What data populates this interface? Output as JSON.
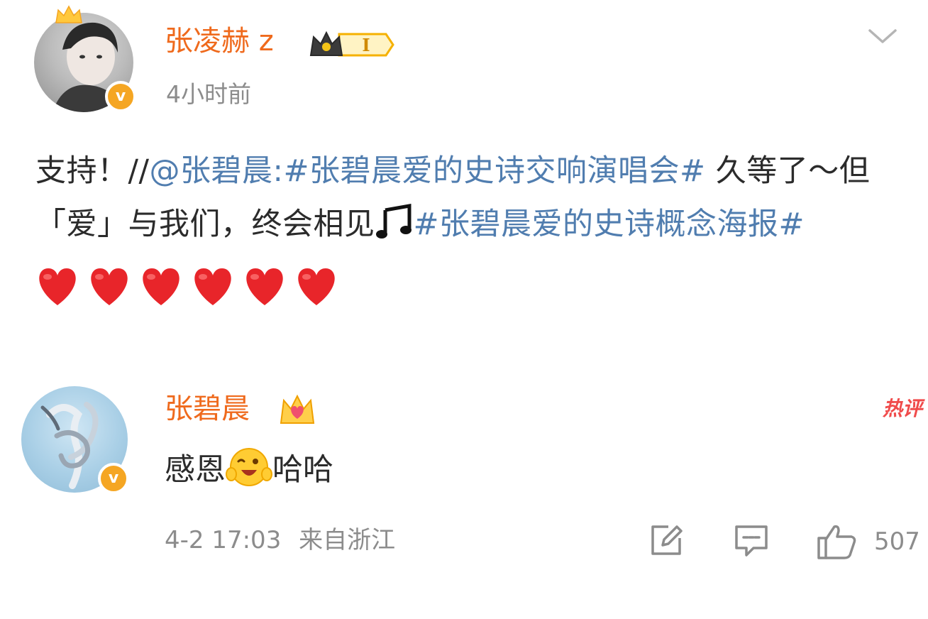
{
  "post": {
    "author": "张凌赫 z",
    "time": "4小时前",
    "body": {
      "p1": "支持！//",
      "mention": "@张碧晨",
      "colon": ":",
      "tag1": "#张碧晨爱的史诗交响演唱会#",
      "p2": " 久等了～但「爱」与我们，终会相见",
      "tag2": "#张碧晨爱的史诗概念海报#"
    },
    "level_badge": "I",
    "emoji_music": "music-note-icon",
    "hearts_count": 6
  },
  "comment": {
    "author": "张碧晨",
    "hot_tag": "热评",
    "text_before": "感恩",
    "text_after": "哈哈",
    "date": "4-2 17:03",
    "location": "来自浙江",
    "like_count": "507"
  },
  "colors": {
    "name": "#ef6a1d",
    "link": "#507daf",
    "muted": "#8c8c8c",
    "verified": "#f5a623",
    "heart": "#e8252a"
  }
}
